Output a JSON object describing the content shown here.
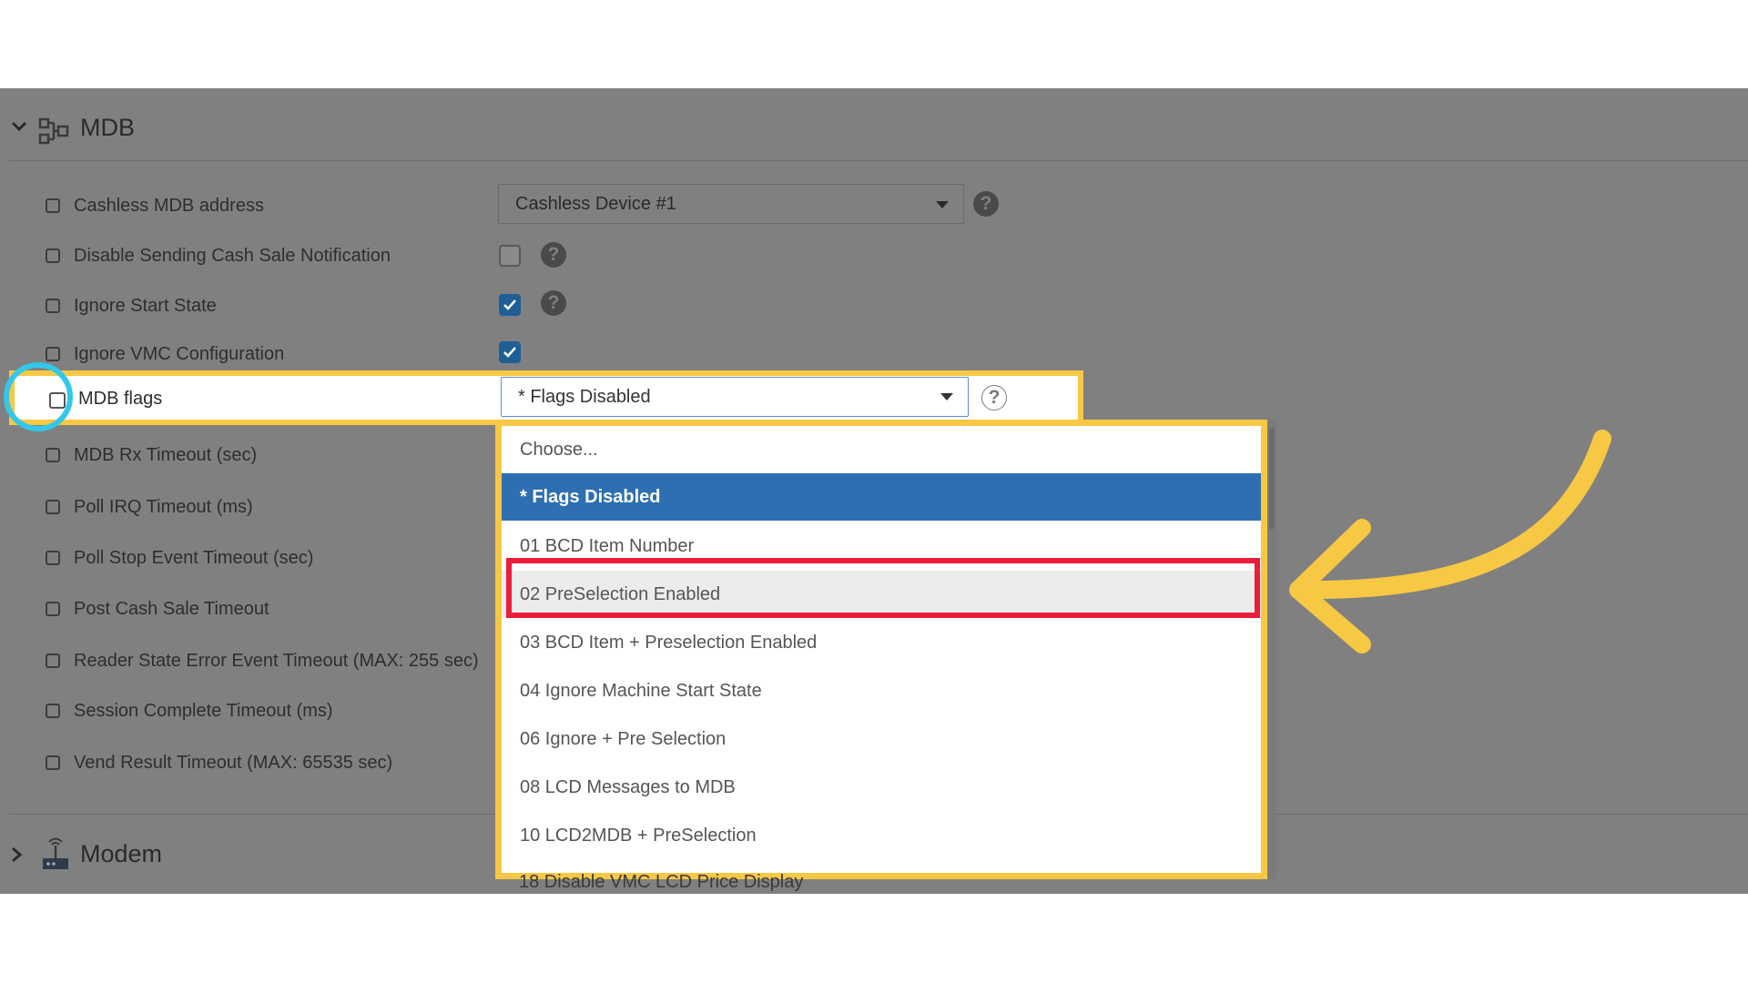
{
  "section": {
    "title": "MDB"
  },
  "rows": [
    {
      "label": "Cashless MDB address"
    },
    {
      "label": "Disable Sending Cash Sale Notification"
    },
    {
      "label": "Ignore Start State"
    },
    {
      "label": "Ignore VMC Configuration"
    },
    {
      "label": "MDB flags"
    },
    {
      "label": "MDB Rx Timeout (sec)"
    },
    {
      "label": "Poll IRQ Timeout (ms)"
    },
    {
      "label": "Poll Stop Event Timeout (sec)"
    },
    {
      "label": "Post Cash Sale Timeout"
    },
    {
      "label": "Reader State Error Event Timeout (MAX: 255 sec)"
    },
    {
      "label": "Session Complete Timeout (ms)"
    },
    {
      "label": "Vend Result Timeout (MAX: 65535 sec)"
    }
  ],
  "cashless_select": {
    "value": "Cashless Device #1"
  },
  "values": {
    "disable_cash_sale_notification": false,
    "ignore_start_state": true,
    "ignore_vmc_configuration": true
  },
  "help_glyph": "?",
  "flags_select": {
    "value": "* Flags Disabled"
  },
  "dropdown": {
    "options": [
      "Choose...",
      "* Flags Disabled",
      "01 BCD Item Number",
      "02 PreSelection Enabled",
      "03 BCD Item + Preselection Enabled",
      "04 Ignore Machine Start State",
      "06 Ignore + Pre Selection",
      "08 LCD Messages to MDB",
      "10 LCD2MDB + PreSelection"
    ],
    "selected": "* Flags Disabled",
    "highlighted": "02 PreSelection Enabled",
    "partially_visible_next": "18 Disable VMC LCD Price Display"
  },
  "modem": {
    "title": "Modem"
  },
  "colors": {
    "overlay": "#808080",
    "highlight_yellow": "#f7c843",
    "ring_cyan": "#33c7ea",
    "red_box": "#ea1d3b",
    "selected_blue": "#2e6fb1"
  }
}
